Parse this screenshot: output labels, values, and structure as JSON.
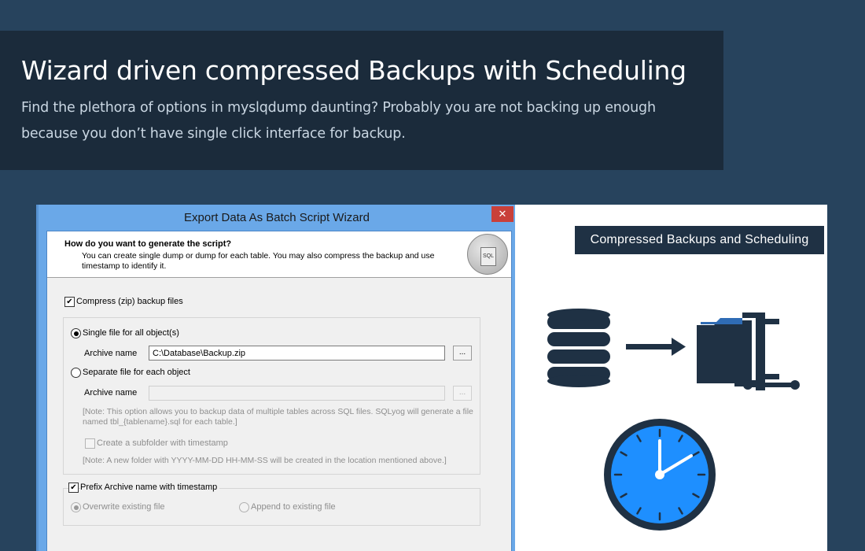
{
  "hero": {
    "title": "Wizard driven compressed Backups with Scheduling",
    "description": "Find the plethora of options in myslqdump daunting? Probably you are not backing up enough because you don’t have single click interface for backup."
  },
  "wizard": {
    "title": "Export Data As Batch Script Wizard",
    "close_label": "✕",
    "question": "How do you want to generate the script?",
    "question_detail": "You can create single dump or dump for each table. You may also compress the backup and use timestamp to identify it.",
    "icon_label": "SQL",
    "compress_label": "Compress (zip) backup files",
    "single_file_label": "Single file for all object(s)",
    "archive_name_label": "Archive name",
    "archive_name_value": "C:\\Database\\Backup.zip",
    "browse_label": "...",
    "separate_file_label": "Separate file for each object",
    "archive_name_label_2": "Archive name",
    "archive_name_value_2": "",
    "browse_label_2": "...",
    "separate_note": "[Note: This option allows you to backup data of multiple tables across SQL files. SQLyog will generate a file named tbl_{tablename}.sql for each table.]",
    "subfolder_label": "Create a subfolder with timestamp",
    "subfolder_note": "[Note: A new folder with YYYY-MM-DD HH-MM-SS will be created in the location mentioned above.]",
    "prefix_label": "Prefix Archive name with timestamp",
    "overwrite_label": "Overwrite existing file",
    "append_label": "Append to existing file"
  },
  "promo": {
    "tag": "Compressed Backups and Scheduling",
    "icons": [
      "database-icon",
      "arrow-icon",
      "compressed-folder-icon",
      "clock-icon"
    ],
    "colors": {
      "dark": "#1f3144",
      "clock_blue": "#1e8fff",
      "folder_blue": "#2f6cb5"
    }
  }
}
